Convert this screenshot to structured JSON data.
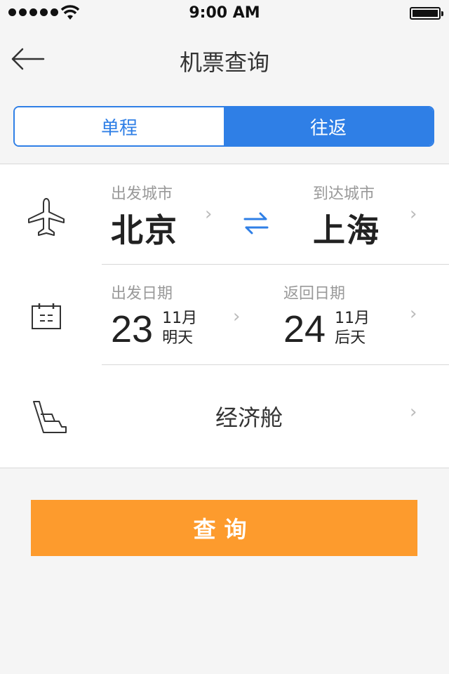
{
  "status_bar": {
    "time": "9:00 AM",
    "signal_dots": 5,
    "icons": [
      "wifi-icon",
      "battery-icon"
    ]
  },
  "nav": {
    "title": "机票查询",
    "back_icon": "back-arrow-icon"
  },
  "trip_type": {
    "one_way": "单程",
    "round_trip": "往返",
    "selected": "往返"
  },
  "cities": {
    "departure_label": "出发城市",
    "departure_city": "北京",
    "arrival_label": "到达城市",
    "arrival_city": "上海",
    "swap_icon": "swap-arrows-icon"
  },
  "dates": {
    "depart_label": "出发日期",
    "depart_day": "23",
    "depart_month": "11月",
    "depart_rel": "明天",
    "return_label": "返回日期",
    "return_day": "24",
    "return_month": "11月",
    "return_rel": "后天"
  },
  "cabin": {
    "label": "经济舱",
    "icon": "seat-icon"
  },
  "search_button": {
    "label": "查询"
  },
  "colors": {
    "accent": "#2f7fe6",
    "button": "#fd9b2d",
    "background": "#f5f5f5"
  }
}
